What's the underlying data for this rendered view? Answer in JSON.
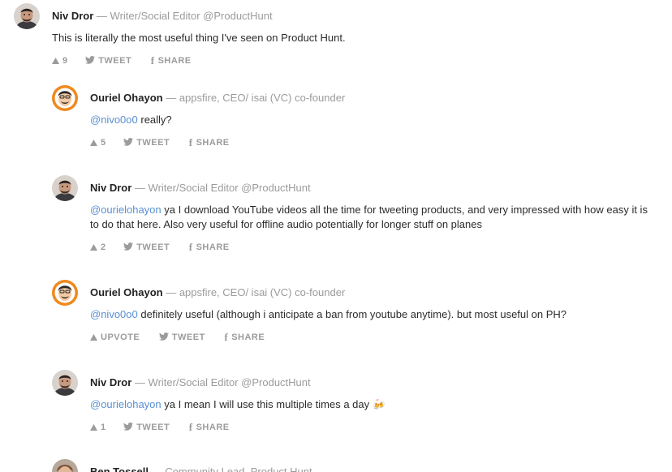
{
  "comments": [
    {
      "author": "Niv Dror",
      "headline": "Writer/Social Editor @ProductHunt",
      "mention": "",
      "text": "This is literally the most useful thing I've seen on Product Hunt.",
      "upvote_label": "9",
      "tweet_label": "TWEET",
      "share_label": "SHARE",
      "avatar": "niv-dror-avatar"
    },
    {
      "author": "Ouriel Ohayon",
      "headline": "appsfire, CEO/ isai (VC) co-founder",
      "mention": "@nivo0o0",
      "text": " really?",
      "upvote_label": "5",
      "tweet_label": "TWEET",
      "share_label": "SHARE",
      "avatar": "ouriel-ohayon-avatar"
    },
    {
      "author": "Niv Dror",
      "headline": "Writer/Social Editor @ProductHunt",
      "mention": "@ourielohayon",
      "text": " ya I download YouTube videos all the time for tweeting products, and very impressed with how easy it is to do that here. Also very useful for offline audio potentially for longer stuff on planes",
      "upvote_label": "2",
      "tweet_label": "TWEET",
      "share_label": "SHARE",
      "avatar": "niv-dror-avatar"
    },
    {
      "author": "Ouriel Ohayon",
      "headline": "appsfire, CEO/ isai (VC) co-founder",
      "mention": "@nivo0o0",
      "text": " definitely useful (although i anticipate a ban from youtube anytime). but most useful on PH?",
      "upvote_label": "UPVOTE",
      "tweet_label": "TWEET",
      "share_label": "SHARE",
      "avatar": "ouriel-ohayon-avatar"
    },
    {
      "author": "Niv Dror",
      "headline": "Writer/Social Editor @ProductHunt",
      "mention": "@ourielohayon",
      "text": " ya I mean I will use this multiple times a day 🍻",
      "upvote_label": "1",
      "tweet_label": "TWEET",
      "share_label": "SHARE",
      "avatar": "niv-dror-avatar"
    },
    {
      "author": "Ben Tossell",
      "headline": "Community Lead, Product Hunt",
      "mention": "",
      "text": "",
      "upvote_label": "",
      "tweet_label": "",
      "share_label": "",
      "avatar": "ben-tossell-avatar"
    }
  ],
  "separator": " — ",
  "colors": {
    "author": "#222222",
    "meta": "#9b9b9b",
    "mention": "#5a8fd3",
    "body": "#2b2b2b"
  },
  "icons": {
    "upvote": "triangle-up-icon",
    "tweet": "twitter-bird-icon",
    "share": "facebook-f-icon"
  }
}
